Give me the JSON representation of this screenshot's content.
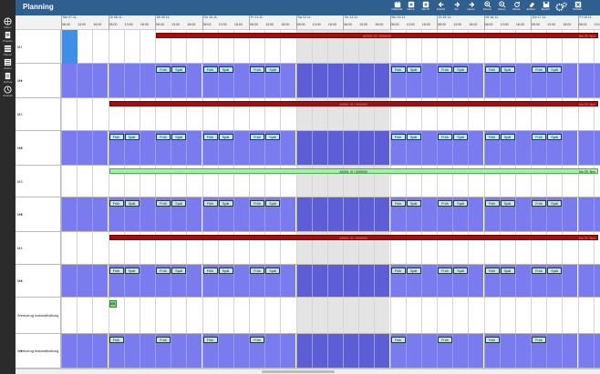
{
  "app": {
    "title": "Planning"
  },
  "sidebar": {
    "items": [
      {
        "label": "Daten",
        "icon": "network-icon"
      },
      {
        "label": "Projekte",
        "icon": "clipboard-icon"
      },
      {
        "label": "Planen",
        "icon": "stack-icon"
      },
      {
        "label": "Zeiten",
        "icon": "list-icon"
      },
      {
        "label": "Auftrag",
        "icon": "document-icon"
      },
      {
        "label": "Statistik",
        "icon": "chart-icon"
      }
    ]
  },
  "toolbar": {
    "buttons": [
      {
        "label": "Kalendar",
        "icon": "calendar-icon"
      },
      {
        "label": "Neu A",
        "icon": "plus-box-icon"
      },
      {
        "label": "Neu B",
        "icon": "plus-box-icon"
      },
      {
        "label": "Zurück",
        "icon": "arrow-left-icon"
      },
      {
        "label": "Vor",
        "icon": "arrow-right-icon"
      },
      {
        "label": "Heute",
        "icon": "arrow-right-icon"
      },
      {
        "label": "Zoom+",
        "icon": "zoom-in-icon"
      },
      {
        "label": "Zoom-",
        "icon": "zoom-out-icon"
      },
      {
        "label": "Aktual.",
        "icon": "refresh-icon"
      },
      {
        "label": "Entfern",
        "icon": "eraser-icon"
      },
      {
        "label": "Speich.",
        "icon": "save-icon"
      },
      {
        "label": "Einst.",
        "icon": "gears-icon"
      },
      {
        "label": "Schließ.",
        "icon": "close-icon"
      }
    ]
  },
  "header": {
    "days": [
      "Mo 07.11.",
      "Di 08.11.",
      "Mi 09.11.",
      "Do 10.11.",
      "Fr 11.11.",
      "Sa 12.11.",
      "So 13.11.",
      "Mo 14.11.",
      "Di 15.11.",
      "Mi 16.11.",
      "Do 17.11.",
      "Fr 18.11."
    ],
    "hours": [
      "08:00",
      "13:00",
      "18:00"
    ]
  },
  "rows": [
    {
      "label": "M1",
      "type": "machine",
      "bar": {
        "text": "A0001 (0 / 300000)",
        "end": "bis 29. Nov",
        "color": "red"
      }
    },
    {
      "label": "M1",
      "type": "shifts",
      "expand": "⇥"
    },
    {
      "label": "M2",
      "type": "machine",
      "bar": {
        "text": "A0001 (0 / 300000)",
        "end": "bis 29. Nov",
        "color": "red"
      }
    },
    {
      "label": "M2",
      "type": "shifts",
      "expand": "⇥"
    },
    {
      "label": "M3",
      "type": "machine",
      "bar": {
        "text": "A0001 (0 / 300000)",
        "end": "bis 29. Nov",
        "color": "green"
      }
    },
    {
      "label": "M3",
      "type": "shifts",
      "expand": "⇥"
    },
    {
      "label": "M4",
      "type": "machine",
      "bar": {
        "text": "A0001 (0 / 300000)",
        "end": "bis 29. Nov",
        "color": "red"
      }
    },
    {
      "label": "M4",
      "type": "shifts",
      "expand": "⇥"
    },
    {
      "label": "Werkzeug Instandhaltung",
      "type": "tool",
      "tag": "WB"
    },
    {
      "label": "Werkzeug Instandhaltung",
      "type": "shifts-single",
      "expand": "⇥"
    }
  ],
  "shift_labels": {
    "early": "Früh",
    "late": "Spät"
  },
  "colors": {
    "topbar": "#2f5f8f",
    "sidebar": "#2b2b2b",
    "shift_row": "#7b7bf0",
    "order_bar_red": "#a01010",
    "order_bar_green": "#a6eeaa"
  }
}
